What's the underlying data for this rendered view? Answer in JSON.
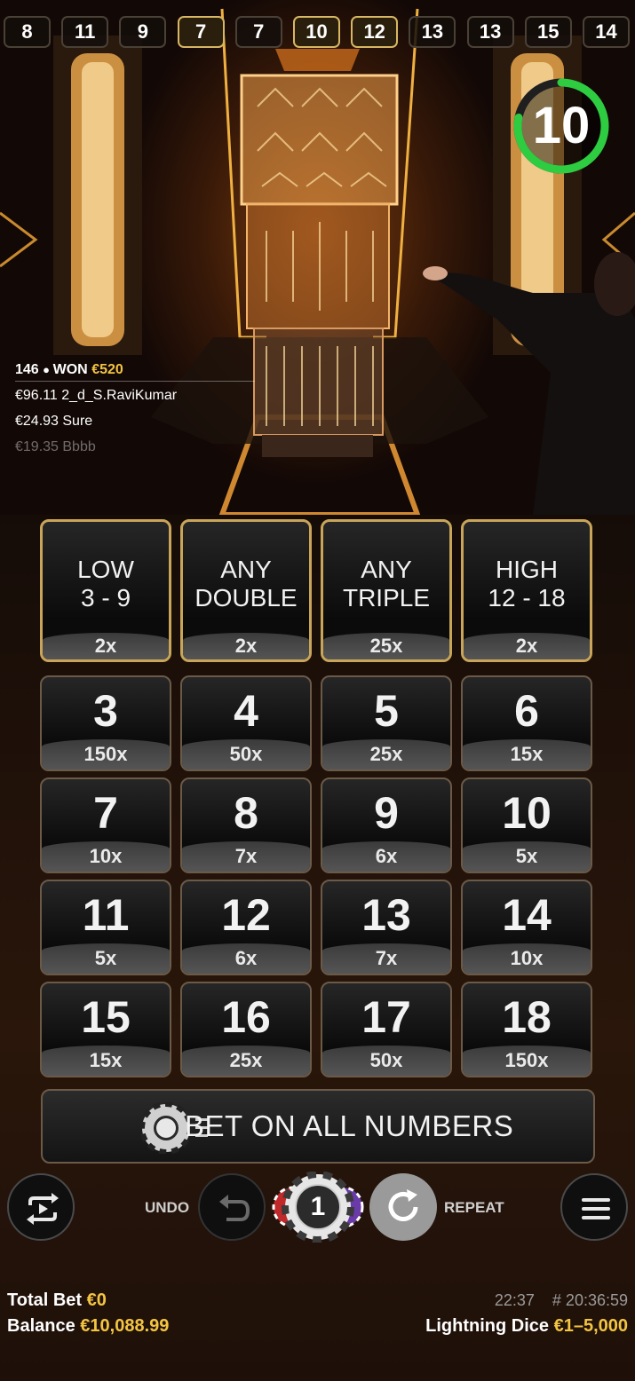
{
  "history": [
    {
      "value": "8",
      "lit": false
    },
    {
      "value": "11",
      "lit": false
    },
    {
      "value": "9",
      "lit": false
    },
    {
      "value": "7",
      "lit": true
    },
    {
      "value": "7",
      "lit": false
    },
    {
      "value": "10",
      "lit": true
    },
    {
      "value": "12",
      "lit": true
    },
    {
      "value": "13",
      "lit": false
    },
    {
      "value": "13",
      "lit": false
    },
    {
      "value": "15",
      "lit": false
    },
    {
      "value": "14",
      "lit": false
    }
  ],
  "timer": {
    "value": "10",
    "progress": 0.78,
    "color": "#2ecc40"
  },
  "winners": {
    "count": "146",
    "won_label": "WON",
    "won_amount": "€520",
    "rows": [
      {
        "text": "€96.11 2_d_S.RaviKumar"
      },
      {
        "text": "€24.93 Sure"
      },
      {
        "text": "€19.35 Bbbb"
      }
    ]
  },
  "top_bets": [
    {
      "line1": "LOW",
      "line2": "3 - 9",
      "payout": "2x"
    },
    {
      "line1": "ANY",
      "line2": "DOUBLE",
      "payout": "2x"
    },
    {
      "line1": "ANY",
      "line2": "TRIPLE",
      "payout": "25x"
    },
    {
      "line1": "HIGH",
      "line2": "12 - 18",
      "payout": "2x"
    }
  ],
  "numbers": [
    {
      "n": "3",
      "payout": "150x"
    },
    {
      "n": "4",
      "payout": "50x"
    },
    {
      "n": "5",
      "payout": "25x"
    },
    {
      "n": "6",
      "payout": "15x"
    },
    {
      "n": "7",
      "payout": "10x"
    },
    {
      "n": "8",
      "payout": "7x"
    },
    {
      "n": "9",
      "payout": "6x"
    },
    {
      "n": "10",
      "payout": "5x"
    },
    {
      "n": "11",
      "payout": "5x"
    },
    {
      "n": "12",
      "payout": "6x"
    },
    {
      "n": "13",
      "payout": "7x"
    },
    {
      "n": "14",
      "payout": "10x"
    },
    {
      "n": "15",
      "payout": "15x"
    },
    {
      "n": "16",
      "payout": "25x"
    },
    {
      "n": "17",
      "payout": "50x"
    },
    {
      "n": "18",
      "payout": "150x"
    }
  ],
  "bet_all_label": "BET ON ALL NUMBERS",
  "controls": {
    "undo_label": "UNDO",
    "repeat_label": "REPEAT",
    "chip_value": "1",
    "icons": {
      "autoplay": "autoplay-icon",
      "undo": "undo-icon",
      "repeat": "repeat-icon",
      "menu": "hamburger-menu-icon"
    }
  },
  "footer": {
    "total_bet_label": "Total Bet",
    "total_bet_value": "€0",
    "balance_label": "Balance",
    "balance_value": "€10,088.99",
    "time": "22:37",
    "round_id": "# 20:36:59",
    "game_name": "Lightning Dice",
    "limits": "€1–5,000"
  },
  "colors": {
    "gold": "#f4c542",
    "tile_border_gold": "#c9a55a",
    "timer_green": "#2ecc40"
  }
}
